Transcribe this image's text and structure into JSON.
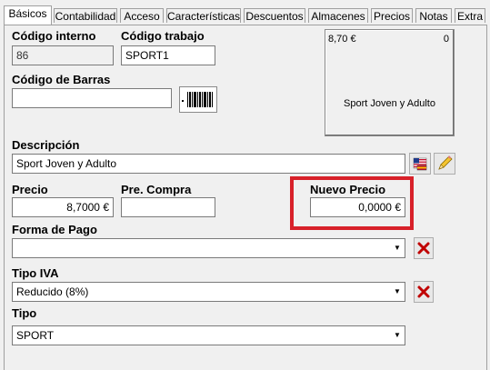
{
  "tabs": [
    {
      "label": "Básicos",
      "active": true
    },
    {
      "label": "Contabilidad",
      "active": false
    },
    {
      "label": "Acceso",
      "active": false
    },
    {
      "label": "Características",
      "active": false
    },
    {
      "label": "Descuentos",
      "active": false
    },
    {
      "label": "Almacenes",
      "active": false
    },
    {
      "label": "Precios",
      "active": false
    },
    {
      "label": "Notas",
      "active": false
    },
    {
      "label": "Extra",
      "active": false
    }
  ],
  "codigo_interno": {
    "label": "Código interno",
    "value": "86"
  },
  "codigo_trabajo": {
    "label": "Código trabajo",
    "value": "SPORT1"
  },
  "codigo_barras": {
    "label": "Código de Barras",
    "value": ""
  },
  "preview": {
    "price": "8,70 €",
    "count": "0",
    "name": "Sport Joven y Adulto"
  },
  "descripcion": {
    "label": "Descripción",
    "value": "Sport Joven y Adulto"
  },
  "precio": {
    "label": "Precio",
    "value": "8,7000 €"
  },
  "pre_compra": {
    "label": "Pre. Compra",
    "value": ""
  },
  "nuevo_precio": {
    "label": "Nuevo Precio",
    "value": "0,0000 €"
  },
  "forma_pago": {
    "label": "Forma de Pago",
    "value": ""
  },
  "tipo_iva": {
    "label": "Tipo IVA",
    "value": "Reducido (8%)"
  },
  "tipo": {
    "label": "Tipo",
    "value": "SPORT"
  },
  "colors": {
    "highlight": "#d8212a",
    "delete_x": "#c00000"
  },
  "icons": [
    "barcode-icon",
    "flag-icon",
    "pencil-icon",
    "delete-icon",
    "combo-arrow-icon"
  ]
}
